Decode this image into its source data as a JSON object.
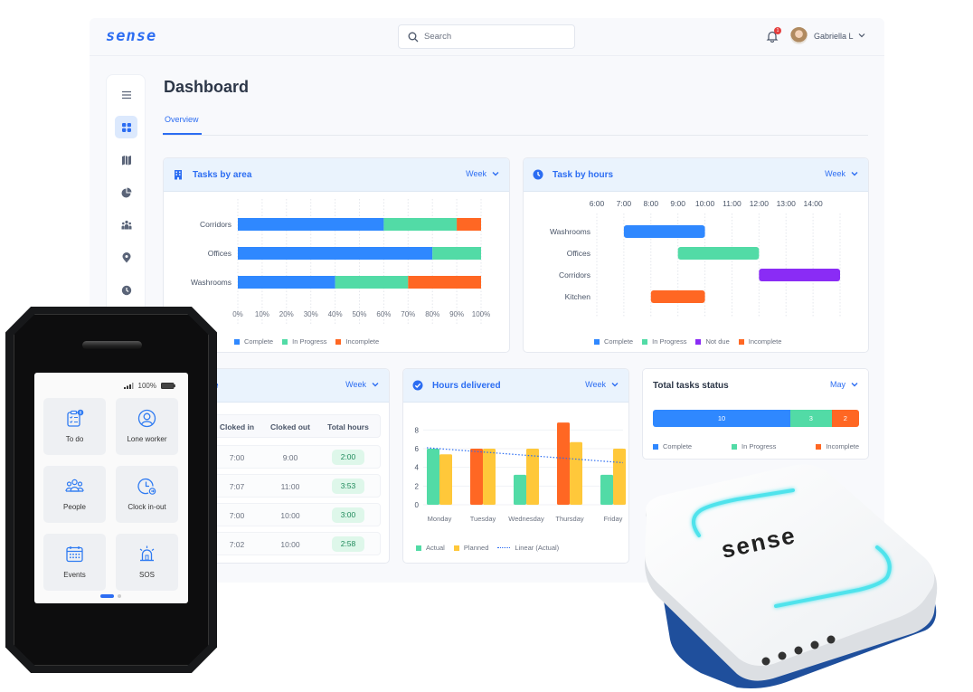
{
  "header": {
    "logo": "sense",
    "search_placeholder": "Search",
    "notification_count": "1",
    "user_name": "Gabriella L"
  },
  "sidebar": {
    "items": [
      {
        "name": "menu",
        "icon": "hamburger-icon"
      },
      {
        "name": "dashboard",
        "icon": "grid-icon",
        "active": true
      },
      {
        "name": "map",
        "icon": "map-icon"
      },
      {
        "name": "reports",
        "icon": "pie-chart-icon"
      },
      {
        "name": "team",
        "icon": "people-icon"
      },
      {
        "name": "locations",
        "icon": "location-pin-icon"
      },
      {
        "name": "time",
        "icon": "clock-icon"
      }
    ]
  },
  "page": {
    "title": "Dashboard",
    "tabs": [
      {
        "label": "Overview",
        "active": true
      }
    ]
  },
  "colors": {
    "accent": "#2c6df2",
    "complete": "#2f88ff",
    "in_progress": "#52dba6",
    "not_due": "#8a2cf5",
    "incomplete": "#ff6723",
    "planned": "#ffc83a"
  },
  "cards": {
    "tasks_by_area": {
      "title": "Tasks by area",
      "period": "Week"
    },
    "task_by_hours": {
      "title": "Task by hours",
      "period": "Week"
    },
    "attendance": {
      "title_visible": "e",
      "period": "Week",
      "columns": [
        "Cloked in",
        "Cloked out",
        "Total hours"
      ],
      "rows": [
        {
          "in": "7:00",
          "out": "9:00",
          "total": "2:00"
        },
        {
          "in": "7:07",
          "out": "11:00",
          "total": "3:53"
        },
        {
          "in": "7:00",
          "out": "10:00",
          "total": "3:00"
        },
        {
          "in": "7:02",
          "out": "10:00",
          "total": "2:58"
        }
      ]
    },
    "hours_delivered": {
      "title": "Hours delivered",
      "period": "Week"
    },
    "total_tasks_status": {
      "title": "Total tasks status",
      "period": "May",
      "segments": [
        {
          "label": "Complete",
          "value": 10
        },
        {
          "label": "In Progress",
          "value": 3
        },
        {
          "label": "Incomplete",
          "value": 2
        }
      ]
    }
  },
  "chart_data": [
    {
      "id": "tasks_by_area",
      "type": "bar",
      "orientation": "horizontal-stacked",
      "categories": [
        "Corridors",
        "Offices",
        "Washrooms"
      ],
      "series": [
        {
          "name": "Complete",
          "values": [
            60,
            80,
            40
          ]
        },
        {
          "name": "In Progress",
          "values": [
            30,
            20,
            30
          ]
        },
        {
          "name": "Incomplete",
          "values": [
            10,
            0,
            30
          ]
        }
      ],
      "x_ticks": [
        "0%",
        "10%",
        "20%",
        "30%",
        "40%",
        "50%",
        "60%",
        "70%",
        "80%",
        "90%",
        "100%"
      ],
      "xlim": [
        0,
        100
      ],
      "legend": [
        "Complete",
        "In Progress",
        "Incomplete"
      ],
      "legend_position": "bottom"
    },
    {
      "id": "task_by_hours",
      "type": "bar",
      "orientation": "gantt",
      "x_ticks": [
        "6:00",
        "7:00",
        "8:00",
        "9:00",
        "10:00",
        "11:00",
        "12:00",
        "13:00",
        "14:00"
      ],
      "xlim": [
        6,
        15
      ],
      "tasks": [
        {
          "label": "Washrooms",
          "start": 7,
          "end": 10,
          "status": "Complete"
        },
        {
          "label": "Offices",
          "start": 9,
          "end": 12,
          "status": "In Progress"
        },
        {
          "label": "Corridors",
          "start": 12,
          "end": 15,
          "status": "Not due"
        },
        {
          "label": "Kitchen",
          "start": 8,
          "end": 10,
          "status": "Incomplete"
        }
      ],
      "legend": [
        "Complete",
        "In Progress",
        "Not due",
        "Incomplete"
      ],
      "legend_position": "bottom"
    },
    {
      "id": "hours_delivered",
      "type": "bar",
      "categories": [
        "Monday",
        "Tuesday",
        "Wednesday",
        "Thursday",
        "Friday"
      ],
      "series": [
        {
          "name": "Actual",
          "values": [
            6,
            6,
            3.2,
            8.8,
            3.2
          ],
          "colors": [
            "in_progress",
            "incomplete",
            "in_progress",
            "incomplete",
            "in_progress"
          ]
        },
        {
          "name": "Planned",
          "values": [
            5.4,
            6,
            6,
            6.7,
            6
          ]
        },
        {
          "name": "Linear (Actual)",
          "type": "line",
          "values": [
            6.1,
            5.7,
            5.3,
            4.9,
            4.5
          ]
        }
      ],
      "y_ticks": [
        "0",
        "2",
        "4",
        "6",
        "8"
      ],
      "ylim": [
        0,
        9
      ],
      "legend": [
        "Actual",
        "Planned",
        "Linear (Actual)"
      ],
      "legend_position": "bottom"
    }
  ],
  "phone": {
    "signal": "signal-icon",
    "battery_text": "100%",
    "tiles": [
      {
        "label": "To do",
        "icon": "clipboard-icon",
        "badge": "8"
      },
      {
        "label": "Lone worker",
        "icon": "user-circle-icon"
      },
      {
        "label": "People",
        "icon": "people-icon"
      },
      {
        "label": "Clock in-out",
        "icon": "clock-arrow-icon"
      },
      {
        "label": "Events",
        "icon": "calendar-icon"
      },
      {
        "label": "SOS",
        "icon": "siren-icon"
      }
    ]
  },
  "sensor": {
    "brand": "sense"
  }
}
